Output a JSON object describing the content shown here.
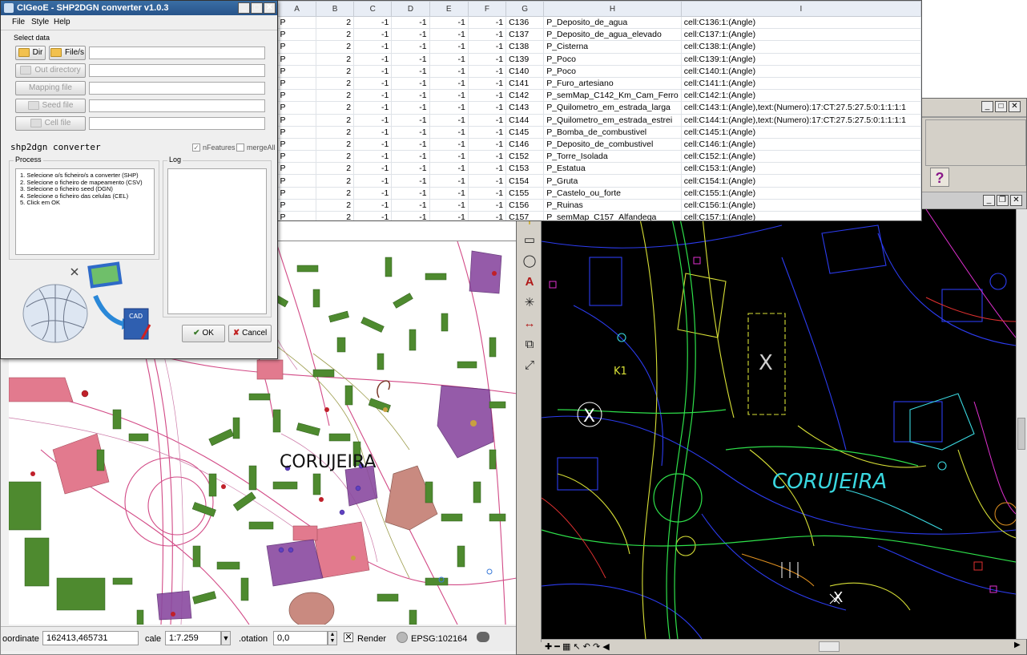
{
  "converter": {
    "title": "CIGeoE - SHP2DGN converter v1.0.3",
    "menu": [
      "File",
      "Style",
      "Help"
    ],
    "select_data_label": "Select data",
    "buttons": {
      "dir": "Dir",
      "files": "File/s",
      "out_directory": "Out directory",
      "mapping_file": "Mapping file",
      "seed_file": "Seed file",
      "cell_file": "Cell file",
      "ok": "OK",
      "cancel": "Cancel"
    },
    "app_name": "shp2dgn converter",
    "options": {
      "nfeatures_label": "nFeatures",
      "nfeatures_checked": true,
      "mergeall_label": "mergeAll",
      "mergeall_checked": false
    },
    "process_label": "Process",
    "log_label": "Log",
    "process_steps": [
      "1. Selecione o/s ficheiro/s a converter (SHP)",
      "2. Selecione o ficheiro de mapeamento (CSV)",
      "3. Selecione o ficheiro seed (DGN)",
      "4. Selecione o ficheiro das celulas (CEL)",
      "5. Click em OK"
    ],
    "cad_badge": "CAD"
  },
  "spreadsheet": {
    "columns": [
      "A",
      "B",
      "C",
      "D",
      "E",
      "F",
      "G",
      "H",
      "I"
    ],
    "rows": [
      [
        "P",
        "2",
        "-1",
        "-1",
        "-1",
        "-1",
        "C136",
        "P_Deposito_de_agua",
        "cell:C136:1:(Angle)"
      ],
      [
        "P",
        "2",
        "-1",
        "-1",
        "-1",
        "-1",
        "C137",
        "P_Deposito_de_agua_elevado",
        "cell:C137:1:(Angle)"
      ],
      [
        "P",
        "2",
        "-1",
        "-1",
        "-1",
        "-1",
        "C138",
        "P_Cisterna",
        "cell:C138:1:(Angle)"
      ],
      [
        "P",
        "2",
        "-1",
        "-1",
        "-1",
        "-1",
        "C139",
        "P_Poco",
        "cell:C139:1:(Angle)"
      ],
      [
        "P",
        "2",
        "-1",
        "-1",
        "-1",
        "-1",
        "C140",
        "P_Poco",
        "cell:C140:1:(Angle)"
      ],
      [
        "P",
        "2",
        "-1",
        "-1",
        "-1",
        "-1",
        "C141",
        "P_Furo_artesiano",
        "cell:C141:1:(Angle)"
      ],
      [
        "P",
        "2",
        "-1",
        "-1",
        "-1",
        "-1",
        "C142",
        "P_semMap_C142_Km_Cam_Ferro",
        "cell:C142:1:(Angle)"
      ],
      [
        "P",
        "2",
        "-1",
        "-1",
        "-1",
        "-1",
        "C143",
        "P_Quilometro_em_estrada_larga",
        "cell:C143:1:(Angle),text:(Numero):17:CT:27.5:27.5:0:1:1:1:1"
      ],
      [
        "P",
        "2",
        "-1",
        "-1",
        "-1",
        "-1",
        "C144",
        "P_Quilometro_em_estrada_estrei",
        "cell:C144:1:(Angle),text:(Numero):17:CT:27.5:27.5:0:1:1:1:1"
      ],
      [
        "P",
        "2",
        "-1",
        "-1",
        "-1",
        "-1",
        "C145",
        "P_Bomba_de_combustivel",
        "cell:C145:1:(Angle)"
      ],
      [
        "P",
        "2",
        "-1",
        "-1",
        "-1",
        "-1",
        "C146",
        "P_Deposito_de_combustivel",
        "cell:C146:1:(Angle)"
      ],
      [
        "P",
        "2",
        "-1",
        "-1",
        "-1",
        "-1",
        "C152",
        "P_Torre_Isolada",
        "cell:C152:1:(Angle)"
      ],
      [
        "P",
        "2",
        "-1",
        "-1",
        "-1",
        "-1",
        "C153",
        "P_Estatua",
        "cell:C153:1:(Angle)"
      ],
      [
        "P",
        "2",
        "-1",
        "-1",
        "-1",
        "-1",
        "C154",
        "P_Gruta",
        "cell:C154:1:(Angle)"
      ],
      [
        "P",
        "2",
        "-1",
        "-1",
        "-1",
        "-1",
        "C155",
        "P_Castelo_ou_forte",
        "cell:C155:1:(Angle)"
      ],
      [
        "P",
        "2",
        "-1",
        "-1",
        "-1",
        "-1",
        "C156",
        "P_Ruinas",
        "cell:C156:1:(Angle)"
      ],
      [
        "P",
        "2",
        "-1",
        "-1",
        "-1",
        "-1",
        "C157",
        "P_semMap_C157_Alfandega",
        "cell:C157:1:(Angle)"
      ]
    ]
  },
  "map": {
    "place_label": "CORUJEIRA",
    "status": {
      "coordinate_label": "oordinate",
      "coordinate_value": "162413,465731",
      "scale_label": "cale",
      "scale_value": "1:7.259",
      "rotation_label": ".otation",
      "rotation_value": "0,0",
      "render_label": "Render",
      "render_checked": true,
      "epsg_label": "EPSG:102164"
    }
  },
  "cad": {
    "place_label": "CORUJEIRA",
    "help_label": "?",
    "marker_labels": [
      "X",
      "X",
      "X",
      "K1"
    ]
  },
  "colors": {
    "buildings_green": "#4e8a2f",
    "road_pink": "#d24a86",
    "purple_area": "#8a4aa0",
    "cad_background": "#000000",
    "cad_blue": "#2c3cf0",
    "cad_yellow": "#d8e036",
    "cad_green": "#2ee04a",
    "cad_cyan": "#3ad8e0",
    "title_blue": "#3a6ea5"
  }
}
